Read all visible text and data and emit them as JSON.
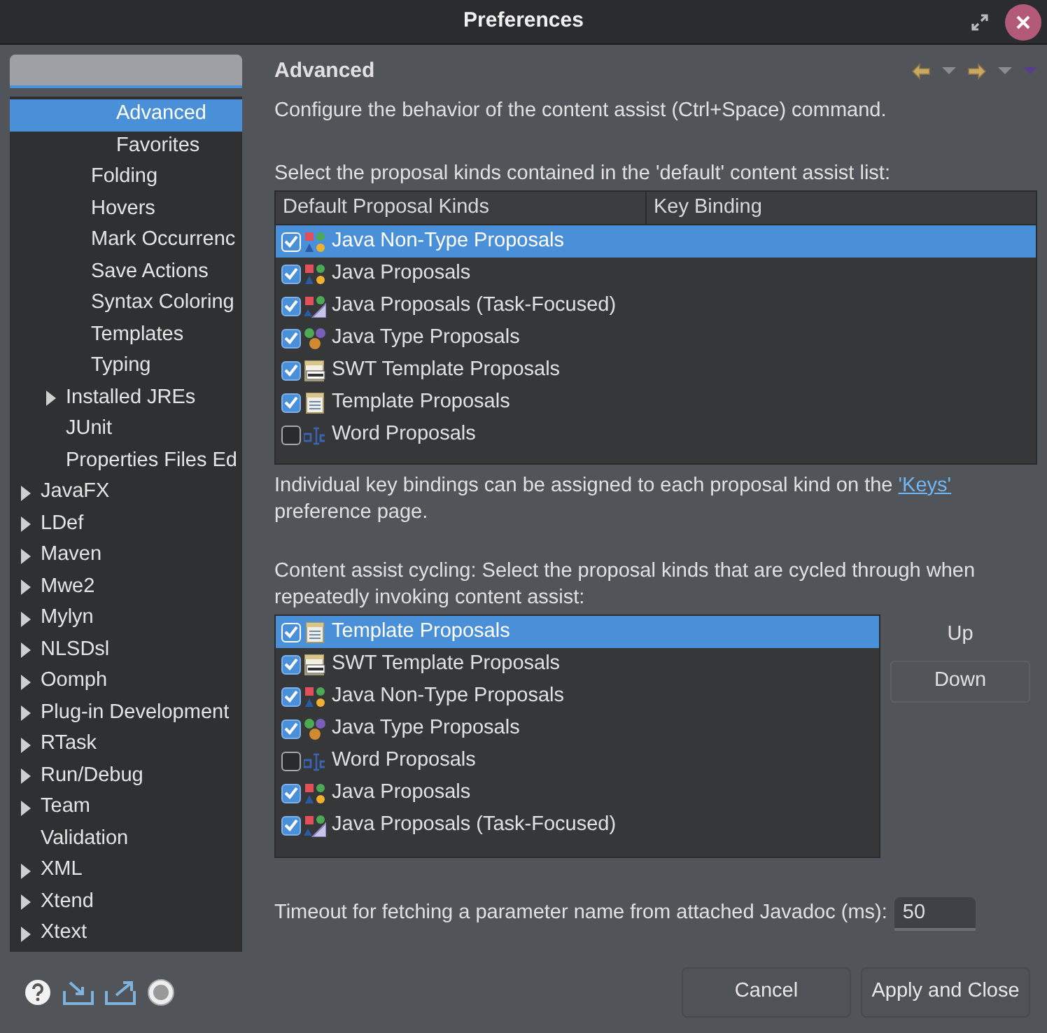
{
  "window": {
    "title": "Preferences"
  },
  "tree": [
    {
      "children": [
        {
          "children": [
            {
              "children": [
                {
                  "label": "Advanced",
                  "kind": "leaf",
                  "selected": true
                },
                {
                  "label": "Favorites",
                  "kind": "leaf",
                  "selected": false
                }
              ]
            },
            {
              "label": "Folding",
              "kind": "leaf",
              "selected": false
            },
            {
              "label": "Hovers",
              "kind": "leaf",
              "selected": false
            },
            {
              "label": "Mark Occurrenc",
              "kind": "leaf",
              "selected": false
            },
            {
              "label": "Save Actions",
              "kind": "leaf",
              "selected": false
            },
            {
              "label": "Syntax Coloring",
              "kind": "leaf",
              "selected": false
            },
            {
              "label": "Templates",
              "kind": "leaf",
              "selected": false
            },
            {
              "label": "Typing",
              "kind": "leaf",
              "selected": false
            }
          ]
        },
        {
          "label": "Installed JREs",
          "kind": "branch",
          "selected": false
        },
        {
          "label": "JUnit",
          "kind": "leaf",
          "selected": false
        },
        {
          "label": "Properties Files Ed",
          "kind": "leaf",
          "selected": false
        }
      ]
    },
    {
      "label": "JavaFX",
      "kind": "branch",
      "selected": false
    },
    {
      "label": "LDef",
      "kind": "branch",
      "selected": false
    },
    {
      "label": "Maven",
      "kind": "branch",
      "selected": false
    },
    {
      "label": "Mwe2",
      "kind": "branch",
      "selected": false
    },
    {
      "label": "Mylyn",
      "kind": "branch",
      "selected": false
    },
    {
      "label": "NLSDsl",
      "kind": "branch",
      "selected": false
    },
    {
      "label": "Oomph",
      "kind": "branch",
      "selected": false
    },
    {
      "label": "Plug-in Development",
      "kind": "branch",
      "selected": false
    },
    {
      "label": "RTask",
      "kind": "branch",
      "selected": false
    },
    {
      "label": "Run/Debug",
      "kind": "branch",
      "selected": false
    },
    {
      "label": "Team",
      "kind": "branch",
      "selected": false
    },
    {
      "label": "Validation",
      "kind": "leaf",
      "selected": false
    },
    {
      "label": "XML",
      "kind": "branch",
      "selected": false
    },
    {
      "label": "Xtend",
      "kind": "branch",
      "selected": false
    },
    {
      "label": "Xtext",
      "kind": "branch",
      "selected": false
    }
  ],
  "page": {
    "title": "Advanced",
    "description": "Configure the behavior of the content assist (Ctrl+Space) command.",
    "default_list": {
      "label": "Select the proposal kinds contained in the 'default' content assist list:",
      "columns": [
        "Default Proposal Kinds",
        "Key Binding"
      ],
      "rows": [
        {
          "kind": "java-non-type",
          "label": "Java Non-Type Proposals",
          "checked": true,
          "selected": true
        },
        {
          "kind": "java",
          "label": "Java Proposals",
          "checked": true,
          "selected": false
        },
        {
          "kind": "java-task",
          "label": "Java Proposals (Task-Focused)",
          "checked": true,
          "selected": false
        },
        {
          "kind": "java-type",
          "label": "Java Type Proposals",
          "checked": true,
          "selected": false
        },
        {
          "kind": "swt-template",
          "label": "SWT Template Proposals",
          "checked": true,
          "selected": false
        },
        {
          "kind": "template",
          "label": "Template Proposals",
          "checked": true,
          "selected": false
        },
        {
          "kind": "word",
          "label": "Word Proposals",
          "checked": false,
          "selected": false
        }
      ]
    },
    "note": {
      "text": "Individual key bindings can be assigned to each proposal kind on the",
      "link": "'Keys'",
      "text_after": "preference page."
    },
    "cycling": {
      "label": "Content assist cycling: Select the proposal kinds that are cycled through when repeatedly invoking content assist:",
      "rows": [
        {
          "kind": "template",
          "label": "Template Proposals",
          "checked": true,
          "selected": true
        },
        {
          "kind": "swt-template",
          "label": "SWT Template Proposals",
          "checked": true,
          "selected": false
        },
        {
          "kind": "java-non-type",
          "label": "Java Non-Type Proposals",
          "checked": true,
          "selected": false
        },
        {
          "kind": "java-type",
          "label": "Java Type Proposals",
          "checked": true,
          "selected": false
        },
        {
          "kind": "word",
          "label": "Word Proposals",
          "checked": false,
          "selected": false
        },
        {
          "kind": "java",
          "label": "Java Proposals",
          "checked": true,
          "selected": false
        },
        {
          "kind": "java-task",
          "label": "Java Proposals (Task-Focused)",
          "checked": true,
          "selected": false
        }
      ],
      "buttons": [
        "Up",
        "Down"
      ]
    },
    "timeout": {
      "label": "Timeout for fetching a parameter name from attached Javadoc (ms):",
      "value": "50"
    }
  },
  "footer": {
    "buttons": [
      "Cancel",
      "Apply and Close"
    ]
  }
}
